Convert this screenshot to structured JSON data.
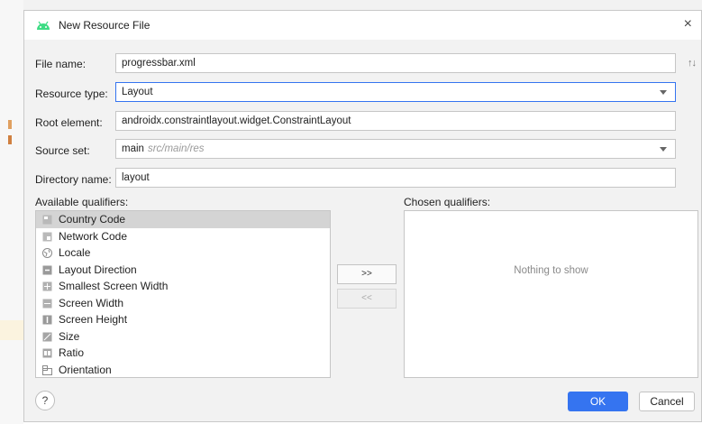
{
  "dialog": {
    "title": "New Resource File",
    "close_glyph": "×",
    "sort_glyph": "↑↓",
    "labels": {
      "file_name": "File name:",
      "resource_type": "Resource type:",
      "root_element": "Root element:",
      "source_set": "Source set:",
      "directory_name": "Directory name:",
      "available_qualifiers": "Available qualifiers:",
      "chosen_qualifiers": "Chosen qualifiers:"
    },
    "fields": {
      "file_name": "progressbar.xml",
      "resource_type": "Layout",
      "root_element": "androidx.constraintlayout.widget.ConstraintLayout",
      "source_set": "main",
      "source_set_hint": "src/main/res",
      "directory_name": "layout"
    },
    "available_qualifiers": [
      {
        "label": "Country Code",
        "icon": "country-code-icon"
      },
      {
        "label": "Network Code",
        "icon": "network-code-icon"
      },
      {
        "label": "Locale",
        "icon": "globe-icon"
      },
      {
        "label": "Layout Direction",
        "icon": "layout-direction-icon"
      },
      {
        "label": "Smallest Screen Width",
        "icon": "smallest-width-icon"
      },
      {
        "label": "Screen Width",
        "icon": "screen-width-icon"
      },
      {
        "label": "Screen Height",
        "icon": "screen-height-icon"
      },
      {
        "label": "Size",
        "icon": "size-icon"
      },
      {
        "label": "Ratio",
        "icon": "ratio-icon"
      },
      {
        "label": "Orientation",
        "icon": "orientation-icon"
      }
    ],
    "add_button": ">>",
    "remove_button": "<<",
    "chosen_empty": "Nothing to show",
    "help_label": "?",
    "ok_label": "OK",
    "cancel_label": "Cancel",
    "colors": {
      "accent": "#3574f0",
      "android_green": "#3ddc84",
      "selection": "#d4d4d4"
    }
  }
}
